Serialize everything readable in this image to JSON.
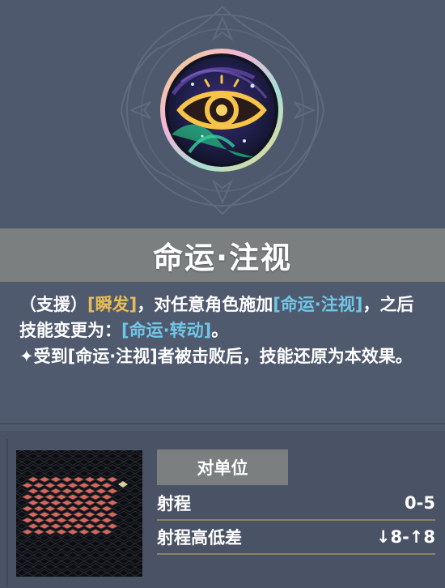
{
  "skill": {
    "name": "命运·注视",
    "icon": "eye-icon"
  },
  "description": {
    "line1": "（支援）",
    "kw_instant": "[瞬发]",
    "line1b": "，对任意角色施加",
    "kw_fate_gaze": "[命运·注视]",
    "line2": "，之后技能变更为：",
    "kw_fate_turn": "[命运·转动]",
    "line2b": "。",
    "line3": "✦受到[命运·注视]者被击败后，技能还原为本效果。"
  },
  "target": {
    "label": "对单位"
  },
  "stats": [
    {
      "label": "射程",
      "value": "0-5"
    },
    {
      "label": "射程高低差",
      "value": "↓8-↑8"
    }
  ],
  "colors": {
    "keyword_gold": "#e7bd55",
    "keyword_blue": "#6fc7e8",
    "tile_red": "#d9685c"
  }
}
